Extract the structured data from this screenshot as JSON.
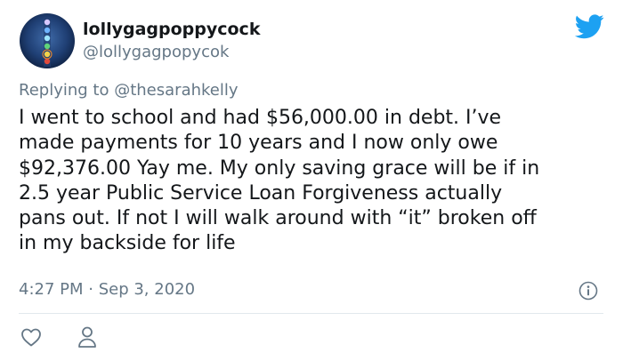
{
  "tweet": {
    "display_name": "lollygagpoppycock",
    "handle": "@lollygagpopycok",
    "replying_to_prefix": "Replying to",
    "replying_to_handle": "@thesarahkelly",
    "body_lines": [
      "I went to school and had $56,000.00 in debt. I’ve",
      "made payments for 10 years and I now only owe",
      "$92,376.00 Yay me. My only saving grace will be if in",
      "2.5 year Public Service Loan Forgiveness actually",
      "pans out. If not I will walk around with “it” broken off",
      "in my backside for life"
    ],
    "timestamp": "4:27 PM · Sep 3, 2020"
  },
  "icons": {
    "logo": "twitter-bird-icon",
    "info": "info-icon",
    "like": "heart-icon",
    "profile": "person-icon"
  },
  "colors": {
    "twitter_blue": "#1da1f2",
    "secondary_text": "#657786",
    "primary_text": "#14171a",
    "divider": "#e1e8ed"
  }
}
